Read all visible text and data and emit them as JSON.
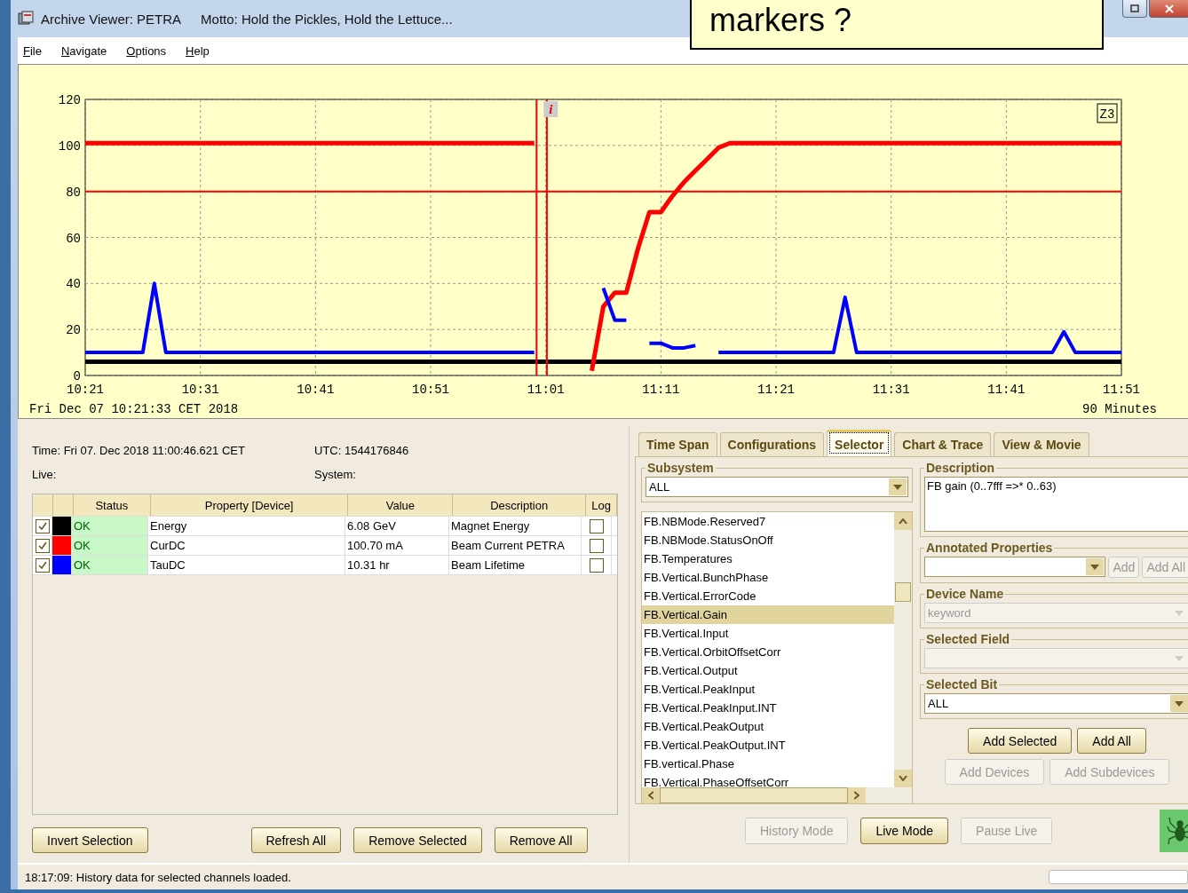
{
  "window": {
    "title": "Archive Viewer: PETRA",
    "motto": "Motto: Hold the Pickles, Hold the Lettuce..."
  },
  "callout": "markers ?",
  "menu": [
    {
      "label": "File"
    },
    {
      "label": "Navigate"
    },
    {
      "label": "Options"
    },
    {
      "label": "Help"
    }
  ],
  "chart": {
    "start_label": "Fri Dec 07 10:21:33 CET 2018",
    "span_label": "90 Minutes",
    "zoom_label": "Z3",
    "info_marker": "i",
    "chart_data": {
      "type": "line",
      "categories": [
        "10:21",
        null,
        null,
        null,
        null,
        null,
        null,
        null,
        null,
        null,
        "10:31",
        null,
        null,
        null,
        null,
        null,
        null,
        null,
        null,
        null,
        "10:41",
        null,
        null,
        null,
        null,
        null,
        null,
        null,
        null,
        null,
        "10:51",
        null,
        null,
        null,
        null,
        null,
        null,
        null,
        null,
        null,
        "11:01",
        null,
        null,
        null,
        null,
        null,
        null,
        null,
        null,
        null,
        "11:11",
        null,
        null,
        null,
        null,
        null,
        null,
        null,
        null,
        null,
        "11:21",
        null,
        null,
        null,
        null,
        null,
        null,
        null,
        null,
        null,
        "11:31",
        null,
        null,
        null,
        null,
        null,
        null,
        null,
        null,
        null,
        "11:41",
        null,
        null,
        null,
        null,
        null,
        null,
        null,
        null,
        null,
        "11:51"
      ],
      "series": [
        {
          "color": "#000000",
          "values": [
            6,
            6,
            6,
            6,
            6,
            6,
            6,
            6,
            6,
            6,
            6,
            6,
            6,
            6,
            6,
            6,
            6,
            6,
            6,
            6,
            6,
            6,
            6,
            6,
            6,
            6,
            6,
            6,
            6,
            6,
            6,
            6,
            6,
            6,
            6,
            6,
            6,
            6,
            6,
            6,
            6,
            6,
            6,
            6,
            6,
            6,
            6,
            6,
            6,
            6,
            6,
            6,
            6,
            6,
            6,
            6,
            6,
            6,
            6,
            6,
            6,
            6,
            6,
            6,
            6,
            6,
            6,
            6,
            6,
            6,
            6,
            6,
            6,
            6,
            6,
            6,
            6,
            6,
            6,
            6,
            6,
            6,
            6,
            6,
            6,
            6,
            6,
            6,
            6,
            6,
            6
          ]
        },
        {
          "color": "#ff0000",
          "values": [
            101,
            101,
            101,
            101,
            101,
            101,
            101,
            101,
            101,
            101,
            101,
            101,
            101,
            101,
            101,
            101,
            101,
            101,
            101,
            101,
            101,
            101,
            101,
            101,
            101,
            101,
            101,
            101,
            101,
            101,
            101,
            101,
            101,
            101,
            101,
            101,
            101,
            101,
            101,
            101,
            null,
            null,
            null,
            null,
            2,
            30,
            36,
            36,
            55,
            71,
            71,
            78,
            84,
            89,
            94,
            99,
            101,
            101,
            101,
            101,
            101,
            101,
            101,
            101,
            101,
            101,
            101,
            101,
            101,
            101,
            101,
            101,
            101,
            101,
            101,
            101,
            101,
            101,
            101,
            101,
            101,
            101,
            101,
            101,
            101,
            101,
            101,
            101,
            101,
            101,
            101
          ]
        },
        {
          "color": "#0000ff",
          "values": [
            10,
            10,
            10,
            10,
            10,
            10,
            40,
            10,
            10,
            10,
            10,
            10,
            10,
            10,
            10,
            10,
            10,
            10,
            10,
            10,
            10,
            10,
            10,
            10,
            10,
            10,
            10,
            10,
            10,
            10,
            10,
            10,
            10,
            10,
            10,
            10,
            10,
            10,
            10,
            10,
            null,
            null,
            null,
            null,
            null,
            38,
            24,
            24,
            null,
            14,
            14,
            12,
            12,
            13,
            null,
            10,
            10,
            10,
            10,
            10,
            10,
            10,
            10,
            10,
            10,
            10,
            34,
            10,
            10,
            10,
            10,
            10,
            10,
            10,
            10,
            10,
            10,
            10,
            10,
            10,
            10,
            10,
            10,
            10,
            10,
            19,
            10,
            10,
            10,
            10,
            10
          ]
        }
      ],
      "ylim": [
        0,
        120
      ],
      "yticks": [
        0,
        20,
        40,
        60,
        80,
        100,
        120
      ],
      "grid": true,
      "ref_lines": [
        {
          "axis": "y",
          "value": 80,
          "color": "#ff0000"
        }
      ]
    }
  },
  "info": {
    "time": "Time: Fri 07. Dec 2018 11:00:46.621 CET",
    "utc": "UTC: 1544176846",
    "live": "Live:",
    "system": "System:"
  },
  "table": {
    "columns": [
      "Status",
      "Property [Device]",
      "Value",
      "Description",
      "Log"
    ],
    "rows": [
      {
        "checked": true,
        "color": "#000000",
        "status": "OK",
        "property": "Energy",
        "value": "6.08 GeV",
        "description": "Magnet Energy",
        "log": false
      },
      {
        "checked": true,
        "color": "#ff0000",
        "status": "OK",
        "property": "CurDC",
        "value": "100.70 mA",
        "description": "Beam Current PETRA",
        "log": false
      },
      {
        "checked": true,
        "color": "#0000ff",
        "status": "OK",
        "property": "TauDC",
        "value": "10.31 hr",
        "description": "Beam Lifetime",
        "log": false
      }
    ]
  },
  "left_buttons": [
    "Invert Selection",
    "Refresh All",
    "Remove Selected",
    "Remove All"
  ],
  "tabs": [
    {
      "label": "Time Span",
      "selected": false
    },
    {
      "label": "Configurations",
      "selected": false
    },
    {
      "label": "Selector",
      "selected": true
    },
    {
      "label": "Chart & Trace",
      "selected": false
    },
    {
      "label": "View & Movie",
      "selected": false
    }
  ],
  "subsystem": {
    "legend": "Subsystem",
    "value": "ALL"
  },
  "properties": [
    {
      "label": "FB.NBMode.Reserved7",
      "selected": false
    },
    {
      "label": "FB.NBMode.StatusOnOff",
      "selected": false
    },
    {
      "label": "FB.Temperatures",
      "selected": false
    },
    {
      "label": "FB.Vertical.BunchPhase",
      "selected": false
    },
    {
      "label": "FB.Vertical.ErrorCode",
      "selected": false
    },
    {
      "label": "FB.Vertical.Gain",
      "selected": true
    },
    {
      "label": "FB.Vertical.Input",
      "selected": false
    },
    {
      "label": "FB.Vertical.OrbitOffsetCorr",
      "selected": false
    },
    {
      "label": "FB.Vertical.Output",
      "selected": false
    },
    {
      "label": "FB.Vertical.PeakInput",
      "selected": false
    },
    {
      "label": "FB.Vertical.PeakInput.INT",
      "selected": false
    },
    {
      "label": "FB.Vertical.PeakOutput",
      "selected": false
    },
    {
      "label": "FB.Vertical.PeakOutput.INT",
      "selected": false
    },
    {
      "label": "FB.vertical.Phase",
      "selected": false
    },
    {
      "label": "FB.Vertical.PhaseOffsetCorr",
      "selected": false
    }
  ],
  "description": {
    "legend": "Description",
    "text": "FB gain (0..7fff =>* 0..63)"
  },
  "annotated": {
    "legend": "Annotated Properties",
    "buttons": [
      {
        "label": "Add",
        "disabled": true
      },
      {
        "label": "Add All",
        "disabled": true
      }
    ]
  },
  "device_name": {
    "legend": "Device Name",
    "placeholder": "keyword",
    "disabled": true
  },
  "selected_field": {
    "legend": "Selected Field",
    "disabled": true
  },
  "selected_bit": {
    "legend": "Selected Bit",
    "value": "ALL"
  },
  "add_buttons": [
    {
      "label": "Add Selected",
      "disabled": false
    },
    {
      "label": "Add All",
      "disabled": false
    },
    {
      "label": "Add Devices",
      "disabled": true
    },
    {
      "label": "Add Subdevices",
      "disabled": true
    }
  ],
  "mode_buttons": [
    {
      "label": "History Mode",
      "disabled": true
    },
    {
      "label": "Live Mode",
      "disabled": false
    },
    {
      "label": "Pause Live",
      "disabled": true
    }
  ],
  "status": "18:17:09: History data for selected channels loaded.",
  "progress": {
    "level": 0
  }
}
